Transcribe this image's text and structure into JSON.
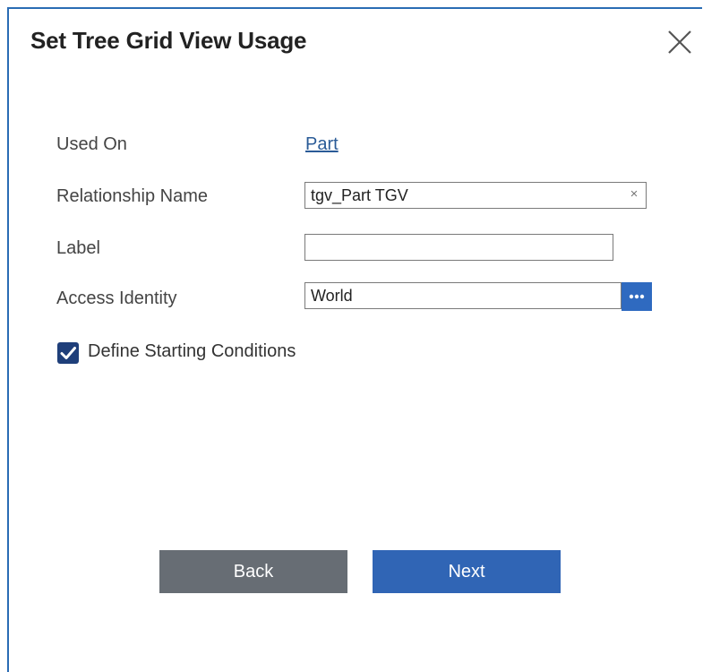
{
  "dialog": {
    "title": "Set Tree Grid View Usage",
    "close_icon": "close-icon"
  },
  "form": {
    "used_on": {
      "label": "Used On",
      "value": "Part"
    },
    "relationship_name": {
      "label": "Relationship Name",
      "value": "tgv_Part TGV",
      "clear_icon": "clear-icon",
      "clear_glyph": "×"
    },
    "label_field": {
      "label": "Label",
      "value": ""
    },
    "access_identity": {
      "label": "Access Identity",
      "value": "World",
      "browse_icon": "more-dots-icon"
    },
    "define_starting_conditions": {
      "label": "Define Starting Conditions",
      "checked": true
    }
  },
  "buttons": {
    "back": "Back",
    "next": "Next"
  },
  "colors": {
    "dialog_border": "#2a6cb4",
    "link": "#2a5b97",
    "checkbox": "#1f3f7a",
    "browse_button": "#2f6ac0",
    "back_button": "#676d74",
    "next_button": "#3065b5"
  }
}
